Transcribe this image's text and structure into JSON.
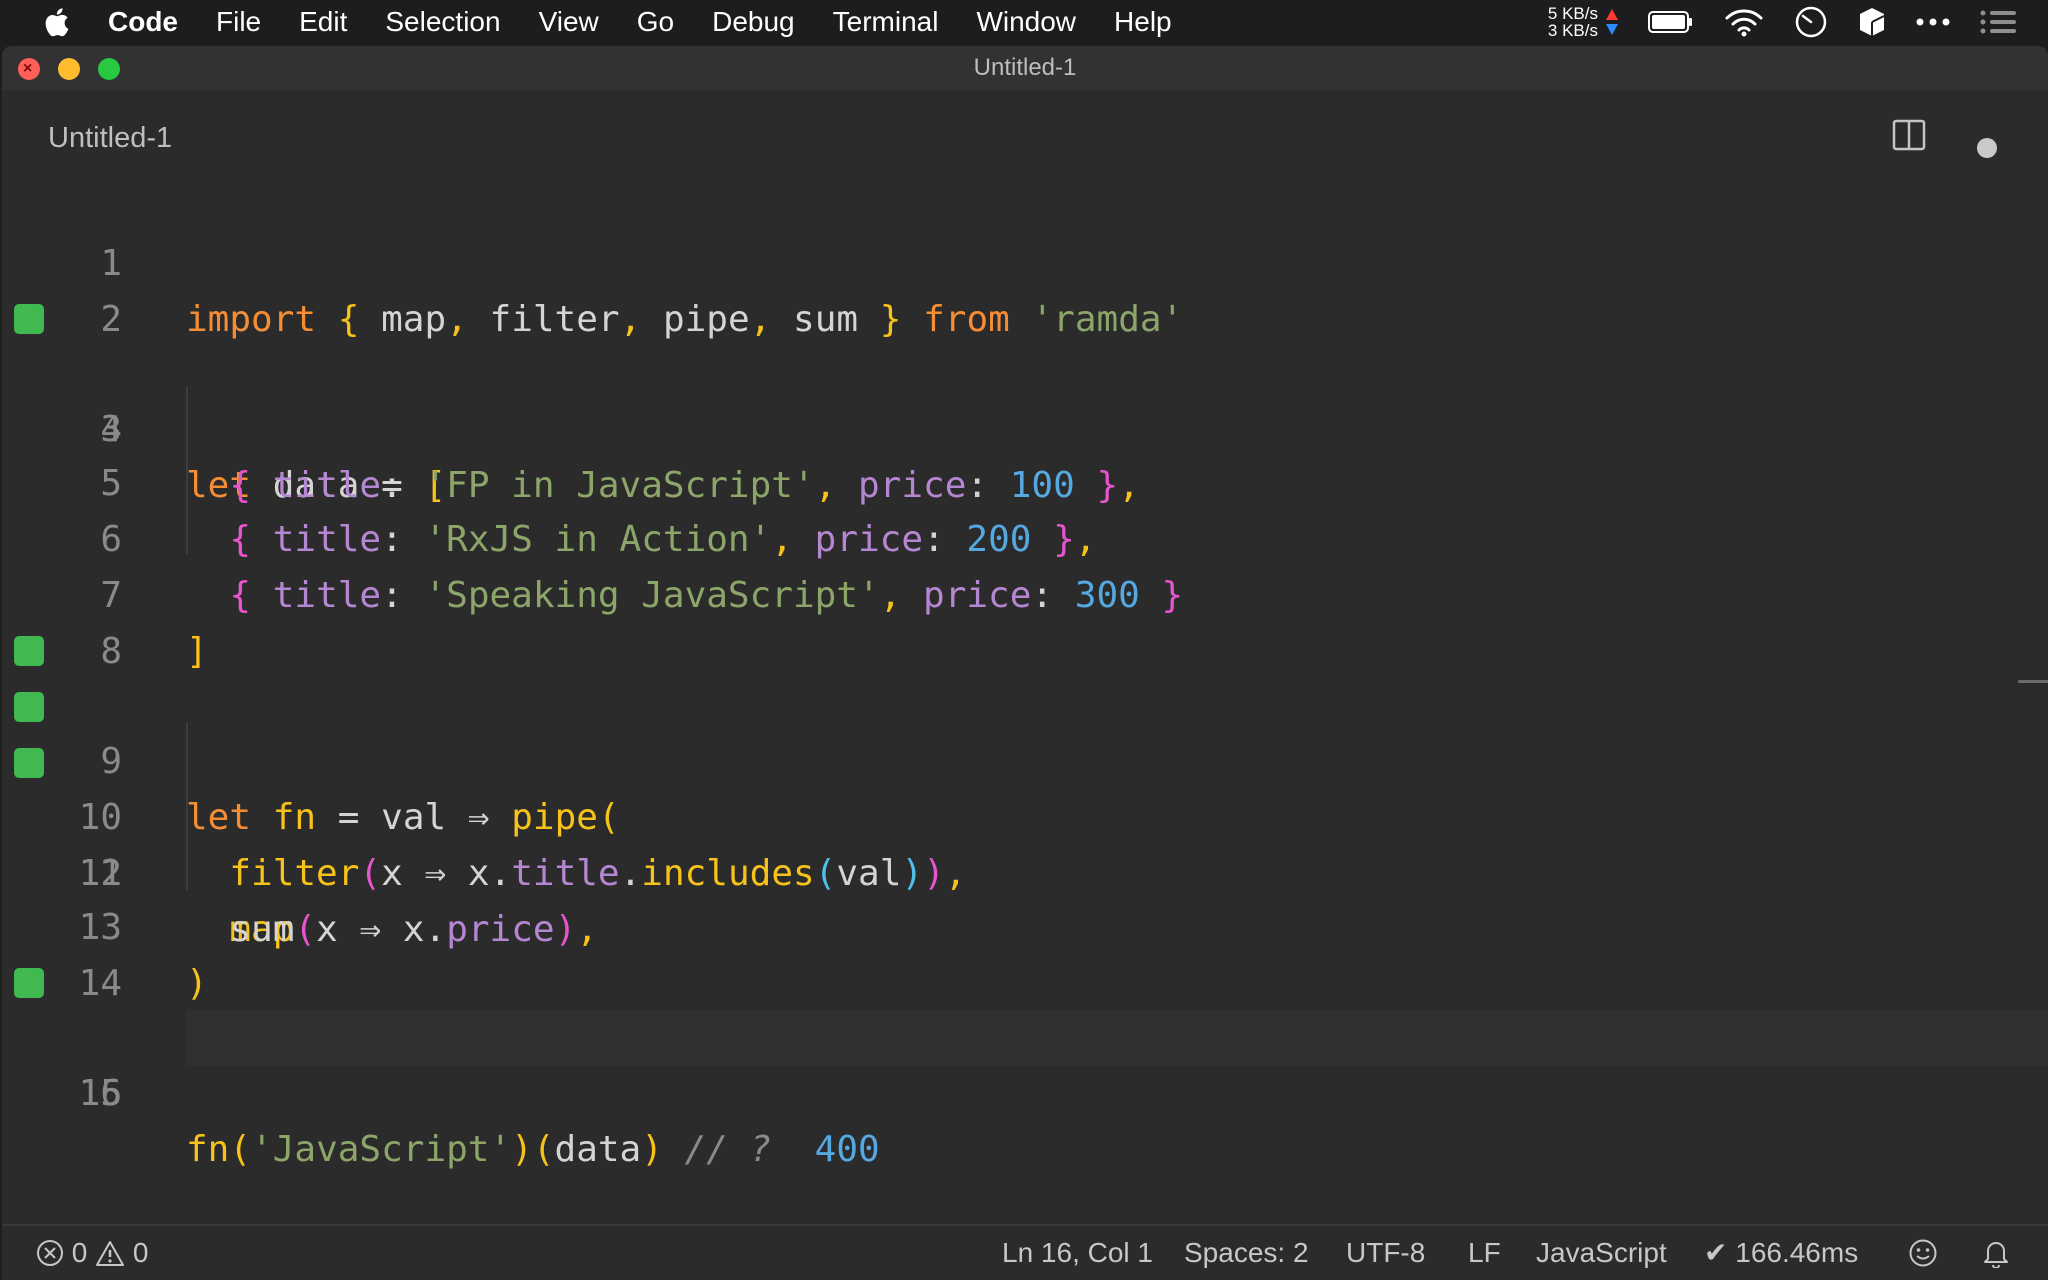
{
  "menubar": {
    "app_name": "Code",
    "items": [
      "File",
      "Edit",
      "Selection",
      "View",
      "Go",
      "Debug",
      "Terminal",
      "Window",
      "Help"
    ],
    "net_up": "5 KB/s",
    "net_down": "3 KB/s",
    "icons": [
      "battery-icon",
      "wifi-icon",
      "clock-icon",
      "box-icon",
      "more-icon",
      "list-icon"
    ]
  },
  "window": {
    "title": "Untitled-1",
    "tab_title": "Untitled-1"
  },
  "editor": {
    "gutter_color": "#3fb950",
    "current_line": 16,
    "lines": [
      {
        "n": "1"
      },
      {
        "n": "2"
      },
      {
        "n": "3"
      },
      {
        "n": "4"
      },
      {
        "n": "5"
      },
      {
        "n": "6"
      },
      {
        "n": "7"
      },
      {
        "n": "8"
      },
      {
        "n": "9"
      },
      {
        "n": "10"
      },
      {
        "n": "11"
      },
      {
        "n": "12"
      },
      {
        "n": "13"
      },
      {
        "n": "14"
      },
      {
        "n": "15"
      },
      {
        "n": "16"
      }
    ],
    "tokens": {
      "l1": [
        "import",
        "{",
        "map",
        ",",
        "filter",
        ",",
        "pipe",
        ",",
        "sum",
        "}",
        "from",
        "'ramda'"
      ],
      "l3": [
        "let",
        "data",
        "=",
        "["
      ],
      "l4": [
        "{",
        "title",
        ":",
        "'FP in JavaScript'",
        ",",
        "price",
        ":",
        "100",
        "}",
        ","
      ],
      "l5": [
        "{",
        "title",
        ":",
        "'RxJS in Action'",
        ",",
        "price",
        ":",
        "200",
        "}",
        ","
      ],
      "l6": [
        "{",
        "title",
        ":",
        "'Speaking JavaScript'",
        ",",
        "price",
        ":",
        "300",
        "}"
      ],
      "l7": [
        "]"
      ],
      "l9": [
        "let",
        "fn",
        "=",
        "val",
        "⇒",
        "pipe",
        "("
      ],
      "l10": [
        "filter",
        "(",
        "x",
        "⇒",
        "x",
        ".",
        "title",
        ".",
        "includes",
        "(",
        "val",
        ")",
        ")",
        ","
      ],
      "l11": [
        "map",
        "(",
        "x",
        "⇒",
        "x",
        ".",
        "price",
        ")",
        ","
      ],
      "l12": [
        "sum"
      ],
      "l13": [
        ")"
      ],
      "l15": [
        "fn",
        "(",
        "'JavaScript'",
        ")",
        "(",
        "data",
        ")",
        "// ?",
        "400"
      ]
    }
  },
  "statusbar": {
    "errors": "0",
    "warnings": "0",
    "position": "Ln 16, Col 1",
    "spaces": "Spaces: 2",
    "encoding": "UTF-8",
    "eol": "LF",
    "language": "JavaScript",
    "timing": "✔ 166.46ms"
  }
}
